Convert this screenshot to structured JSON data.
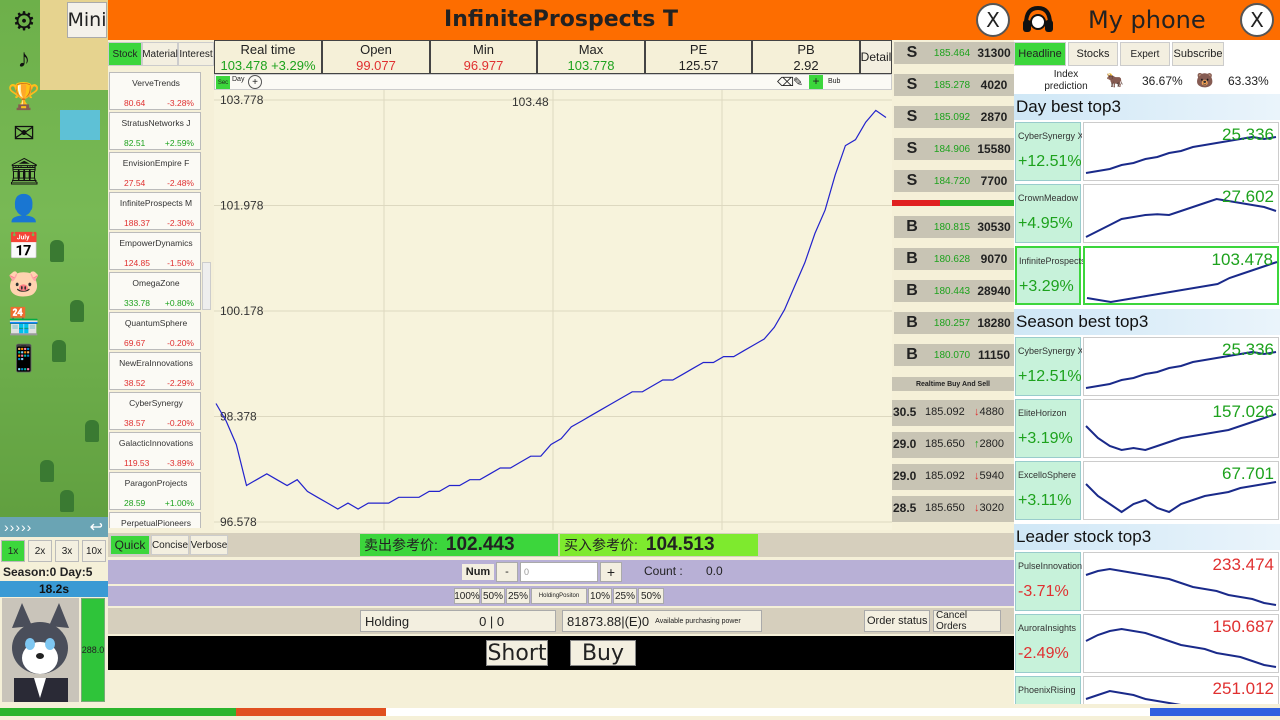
{
  "left_sidebar": {
    "icons": [
      "gear-icon",
      "music-note-icon",
      "trophy-icon",
      "mail-icon",
      "bank-icon",
      "person-icon",
      "calendar-icon",
      "piggy-bank-icon",
      "store-icon",
      "phone-icon"
    ],
    "mini_label": "Mini",
    "speeds": [
      "1x",
      "2x",
      "3x",
      "10x"
    ],
    "selected_speed": "1x",
    "season_day": "Season:0  Day:5",
    "timer": "18.2s",
    "energy": "288.0"
  },
  "main": {
    "title": "InfiniteProspects T",
    "close_label": "X",
    "list_tabs": [
      "Stock",
      "Material",
      "Interest"
    ],
    "stock_list": [
      {
        "name": "VerveTrends",
        "price": "80.64",
        "change": "-3.28%",
        "up": false
      },
      {
        "name": "StratusNetworks J",
        "price": "82.51",
        "change": "+2.59%",
        "up": true
      },
      {
        "name": "EnvisionEmpire F",
        "price": "27.54",
        "change": "-2.48%",
        "up": false
      },
      {
        "name": "InfiniteProspects M",
        "price": "188.37",
        "change": "-2.30%",
        "up": false
      },
      {
        "name": "EmpowerDynamics",
        "price": "124.85",
        "change": "-1.50%",
        "up": false
      },
      {
        "name": "OmegaZone",
        "price": "333.78",
        "change": "+0.80%",
        "up": true
      },
      {
        "name": "QuantumSphere",
        "price": "69.67",
        "change": "-0.20%",
        "up": false
      },
      {
        "name": "NewEraInnovations",
        "price": "38.52",
        "change": "-2.29%",
        "up": false
      },
      {
        "name": "CyberSynergy",
        "price": "38.57",
        "change": "-0.20%",
        "up": false
      },
      {
        "name": "GalacticInnovations",
        "price": "119.53",
        "change": "-3.89%",
        "up": false
      },
      {
        "name": "ParagonProjects",
        "price": "28.59",
        "change": "+1.00%",
        "up": true
      },
      {
        "name": "PerpetualPioneers",
        "price": "",
        "change": "",
        "up": false
      }
    ],
    "stats": {
      "realtime_label": "Real time",
      "realtime_value": "103.478 +3.29%",
      "open_label": "Open",
      "open_value": "99.077",
      "min_label": "Min",
      "min_value": "96.977",
      "max_label": "Max",
      "max_value": "103.778",
      "pe_label": "PE",
      "pe_value": "125.57",
      "pb_label": "PB",
      "pb_value": "2.92",
      "detail_label": "Detail"
    },
    "chart_tools": {
      "sec": "Sec",
      "day": "Day",
      "plus": "+",
      "bub": "Bub"
    },
    "sell_orders": [
      {
        "side": "S",
        "price": "185.464",
        "qty": "31300"
      },
      {
        "side": "S",
        "price": "185.278",
        "qty": "4020"
      },
      {
        "side": "S",
        "price": "185.092",
        "qty": "2870"
      },
      {
        "side": "S",
        "price": "184.906",
        "qty": "15580"
      },
      {
        "side": "S",
        "price": "184.720",
        "qty": "7700"
      }
    ],
    "buy_orders": [
      {
        "side": "B",
        "price": "180.815",
        "qty": "30530"
      },
      {
        "side": "B",
        "price": "180.628",
        "qty": "9070"
      },
      {
        "side": "B",
        "price": "180.443",
        "qty": "28940"
      },
      {
        "side": "B",
        "price": "180.257",
        "qty": "18280"
      },
      {
        "side": "B",
        "price": "180.070",
        "qty": "11150"
      }
    ],
    "realtime_btn": "Realtime Buy And Sell",
    "trades": [
      {
        "t": "30.5",
        "price": "185.092",
        "dir": "↓",
        "qty": "4880"
      },
      {
        "t": "29.0",
        "price": "185.650",
        "dir": "↑",
        "qty": "2800"
      },
      {
        "t": "29.0",
        "price": "185.092",
        "dir": "↓",
        "qty": "5940"
      },
      {
        "t": "28.5",
        "price": "185.650",
        "dir": "↓",
        "qty": "3020"
      }
    ],
    "modes": [
      "Quick",
      "Concise",
      "Verbose"
    ],
    "sell_ref_label": "卖出参考价:",
    "sell_ref_value": "102.443",
    "buy_ref_label": "买入参考价:",
    "buy_ref_value": "104.513",
    "num_label": "Num",
    "minus": "-",
    "num_value": "0",
    "plus": "+",
    "count_label": "Count :",
    "count_value": "0.0",
    "pct_left": [
      "100%",
      "50%",
      "25%"
    ],
    "holding_position": "HoldingPositon",
    "pct_right": [
      "10%",
      "25%",
      "50%"
    ],
    "holding_label": "Holding",
    "holding_value": "0 | 0",
    "funds_value": "81873.88|(E)0",
    "funds_label": "Available purchasing power",
    "order_status": "Order status",
    "cancel_orders": "Cancel Orders",
    "short_label": "Short",
    "buy_label": "Buy"
  },
  "chart_data": {
    "type": "line",
    "ylim": [
      96.578,
      103.778
    ],
    "y_ticks": [
      "103.778",
      "101.978",
      "100.178",
      "98.378",
      "96.578"
    ],
    "annotation": "103.48",
    "line_color": "#2222cc",
    "values": [
      98.6,
      98.3,
      97.9,
      97.2,
      97.3,
      97.4,
      97.3,
      97.2,
      97.3,
      97.1,
      97.0,
      96.9,
      96.8,
      96.9,
      96.8,
      96.9,
      96.9,
      96.9,
      97.0,
      97.0,
      97.0,
      97.1,
      97.1,
      97.2,
      97.2,
      97.3,
      97.3,
      97.4,
      97.5,
      97.5,
      97.6,
      97.7,
      97.7,
      97.9,
      98.0,
      98.2,
      98.3,
      98.4,
      98.5,
      98.6,
      98.7,
      98.8,
      98.8,
      98.9,
      99.0,
      99.0,
      99.1,
      99.2,
      99.3,
      99.3,
      99.4,
      99.4,
      99.5,
      99.6,
      99.7,
      99.9,
      100.2,
      100.6,
      101.0,
      101.5,
      101.9,
      102.5,
      103.0,
      103.1,
      103.4,
      103.6,
      103.48
    ],
    "series": [
      {
        "values_ref": "values"
      }
    ]
  },
  "phone": {
    "title": "My phone",
    "close_label": "X",
    "tabs": [
      "Headline",
      "Stocks",
      "Expert",
      "Subscribe"
    ],
    "index_label": "Index prediction",
    "bull_value": "36.67%",
    "bear_value": "63.33%",
    "sections": [
      {
        "title": "Day best top3",
        "cards": [
          {
            "name": "CyberSynergy X",
            "pct": "+12.51%",
            "value": "25.336",
            "up": true,
            "spark": [
              0.1,
              0.15,
              0.2,
              0.3,
              0.35,
              0.45,
              0.5,
              0.6,
              0.65,
              0.75,
              0.8,
              0.85,
              0.9,
              0.95,
              1.0,
              0.95,
              1.0
            ]
          },
          {
            "name": "CrownMeadow",
            "pct": "+4.95%",
            "value": "27.602",
            "up": true,
            "spark": [
              0.05,
              0.2,
              0.35,
              0.5,
              0.55,
              0.6,
              0.62,
              0.6,
              0.7,
              0.8,
              0.9,
              1.0,
              0.95,
              0.9,
              0.85,
              0.8,
              0.7
            ]
          },
          {
            "name": "InfiniteProspects T",
            "pct": "+3.29%",
            "value": "103.478",
            "up": true,
            "spark": [
              0.1,
              0.05,
              0.0,
              0.05,
              0.1,
              0.15,
              0.2,
              0.25,
              0.3,
              0.35,
              0.4,
              0.45,
              0.6,
              0.7,
              0.8,
              0.9,
              1.0
            ]
          }
        ]
      },
      {
        "title": "Season best top3",
        "cards": [
          {
            "name": "CyberSynergy X",
            "pct": "+12.51%",
            "value": "25.336",
            "up": true,
            "spark": [
              0.1,
              0.15,
              0.2,
              0.3,
              0.35,
              0.45,
              0.5,
              0.6,
              0.65,
              0.75,
              0.8,
              0.85,
              0.9,
              0.95,
              1.0,
              0.95,
              1.0
            ]
          },
          {
            "name": "EliteHorizon",
            "pct": "+3.19%",
            "value": "157.026",
            "up": true,
            "spark": [
              0.7,
              0.4,
              0.2,
              0.1,
              0.15,
              0.1,
              0.2,
              0.3,
              0.4,
              0.45,
              0.5,
              0.55,
              0.6,
              0.7,
              0.8,
              0.9,
              1.0
            ]
          },
          {
            "name": "ExcelloSphere",
            "pct": "+3.11%",
            "value": "67.701",
            "up": true,
            "spark": [
              0.8,
              0.5,
              0.3,
              0.1,
              0.3,
              0.4,
              0.2,
              0.1,
              0.3,
              0.4,
              0.5,
              0.55,
              0.6,
              0.7,
              0.75,
              0.8,
              0.85
            ]
          }
        ]
      },
      {
        "title": "Leader stock top3",
        "cards": [
          {
            "name": "PulseInnovations U",
            "pct": "-3.71%",
            "value": "233.474",
            "up": false,
            "spark": [
              0.8,
              0.9,
              0.95,
              0.9,
              0.85,
              0.8,
              0.75,
              0.7,
              0.6,
              0.5,
              0.45,
              0.4,
              0.3,
              0.25,
              0.2,
              0.1,
              0.05
            ]
          },
          {
            "name": "AuroraInsights",
            "pct": "-2.49%",
            "value": "150.687",
            "up": false,
            "spark": [
              0.7,
              0.85,
              0.95,
              1.0,
              0.95,
              0.9,
              0.8,
              0.7,
              0.6,
              0.55,
              0.5,
              0.4,
              0.35,
              0.3,
              0.2,
              0.1,
              0.05
            ]
          },
          {
            "name": "PhoenixRising",
            "pct": "",
            "value": "251.012",
            "up": false,
            "spark": [
              0.8,
              0.9,
              1.0,
              0.95,
              0.9,
              0.8,
              0.75,
              0.7,
              0.65,
              0.6,
              0.55,
              0.5,
              0.45,
              0.4,
              0.35,
              0.3,
              0.25
            ]
          }
        ]
      }
    ]
  },
  "progress_colors": [
    "#2cb52c",
    "#e05020",
    "#ffffff",
    "#3060e0"
  ]
}
